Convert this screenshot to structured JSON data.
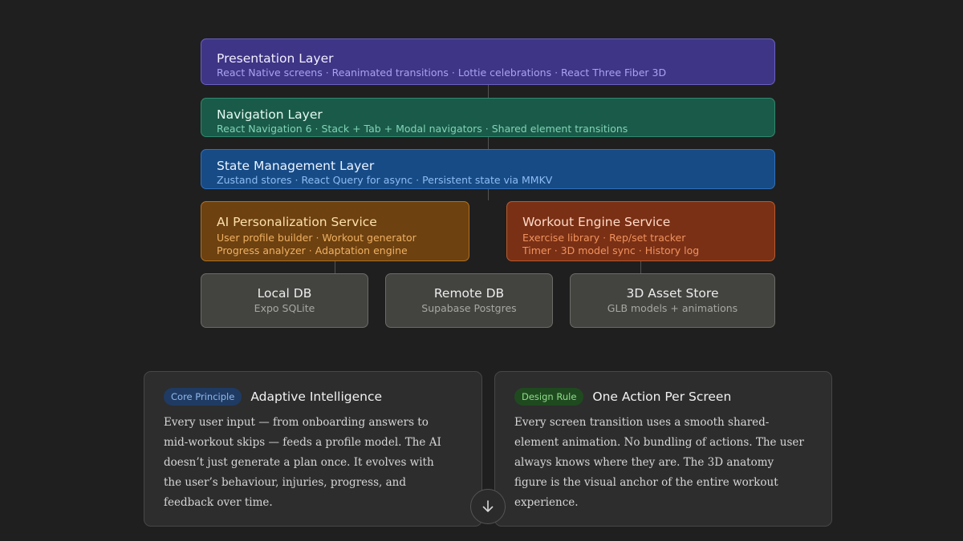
{
  "layers": {
    "presentation": {
      "title": "Presentation Layer",
      "subtitle": "React Native screens · Reanimated transitions · Lottie celebrations · React Three Fiber 3D"
    },
    "navigation": {
      "title": "Navigation Layer",
      "subtitle": "React Navigation 6 · Stack + Tab + Modal navigators · Shared element transitions"
    },
    "state": {
      "title": "State Management Layer",
      "subtitle": "Zustand stores · React Query for async · Persistent state via MMKV"
    }
  },
  "services": {
    "ai": {
      "title": "AI Personalization Service",
      "line1": "User profile builder · Workout generator",
      "line2": "Progress analyzer · Adaptation engine"
    },
    "workout": {
      "title": "Workout Engine Service",
      "line1": "Exercise library · Rep/set tracker",
      "line2": "Timer · 3D model sync · History log"
    }
  },
  "stores": [
    {
      "title": "Local DB",
      "subtitle": "Expo SQLite"
    },
    {
      "title": "Remote DB",
      "subtitle": "Supabase Postgres"
    },
    {
      "title": "3D Asset Store",
      "subtitle": "GLB models + animations"
    }
  ],
  "cards": [
    {
      "badge": "Core Principle",
      "title": "Adaptive Intelligence",
      "lines": [
        "Every user input — from onboarding answers to",
        "mid-workout skips — feeds a profile model. The AI",
        "doesn’t just generate a plan once. It evolves with",
        "the user’s behaviour, injuries, progress, and",
        "feedback over time."
      ]
    },
    {
      "badge": "Design Rule",
      "title": "One Action Per Screen",
      "lines": [
        "Every screen transition uses a smooth shared-",
        "element animation. No bundling of actions. The user",
        "always knows where they are. The 3D anatomy",
        "figure is the visual anchor of the entire workout",
        "experience."
      ]
    }
  ],
  "colors": {
    "presentation_bg": "#3e3586",
    "navigation_bg": "#1a5a48",
    "state_bg": "#174b86",
    "ai_bg": "#6d4110",
    "workout_bg": "#7a3015"
  },
  "icons": {
    "scroll": "arrow-down-icon"
  }
}
